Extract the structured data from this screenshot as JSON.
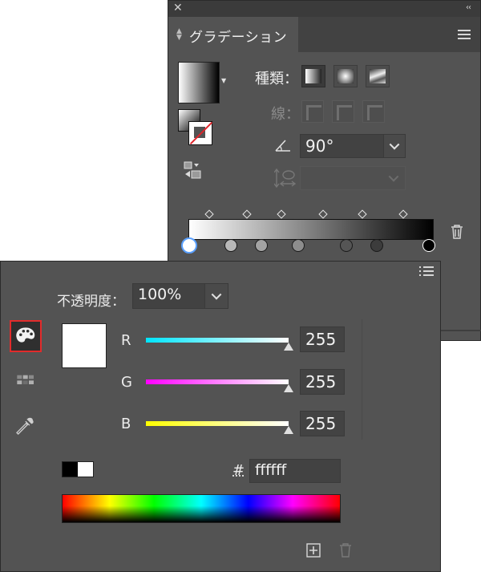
{
  "gradient_panel": {
    "title": "グラデーション",
    "type_label": "種類：",
    "stroke_label": "線：",
    "angle_value": "90°",
    "icons": {
      "close": "close-icon",
      "collapse": "collapse-icon",
      "menu": "panel-menu-icon"
    }
  },
  "color_panel": {
    "opacity_label": "不透明度：",
    "opacity_value": "100%",
    "channels": [
      {
        "label": "R",
        "value": "255",
        "color": "#00e5ff"
      },
      {
        "label": "G",
        "value": "255",
        "color": "#ff00ff"
      },
      {
        "label": "B",
        "value": "255",
        "color": "#ffff00"
      }
    ],
    "hex_label": "#",
    "hex_value": "ffffff",
    "selected_color": "#ffffff"
  },
  "colors": {
    "panel_bg": "#535353",
    "highlight_border": "#e22b2b",
    "selected_stop": "#5aa0ff"
  }
}
